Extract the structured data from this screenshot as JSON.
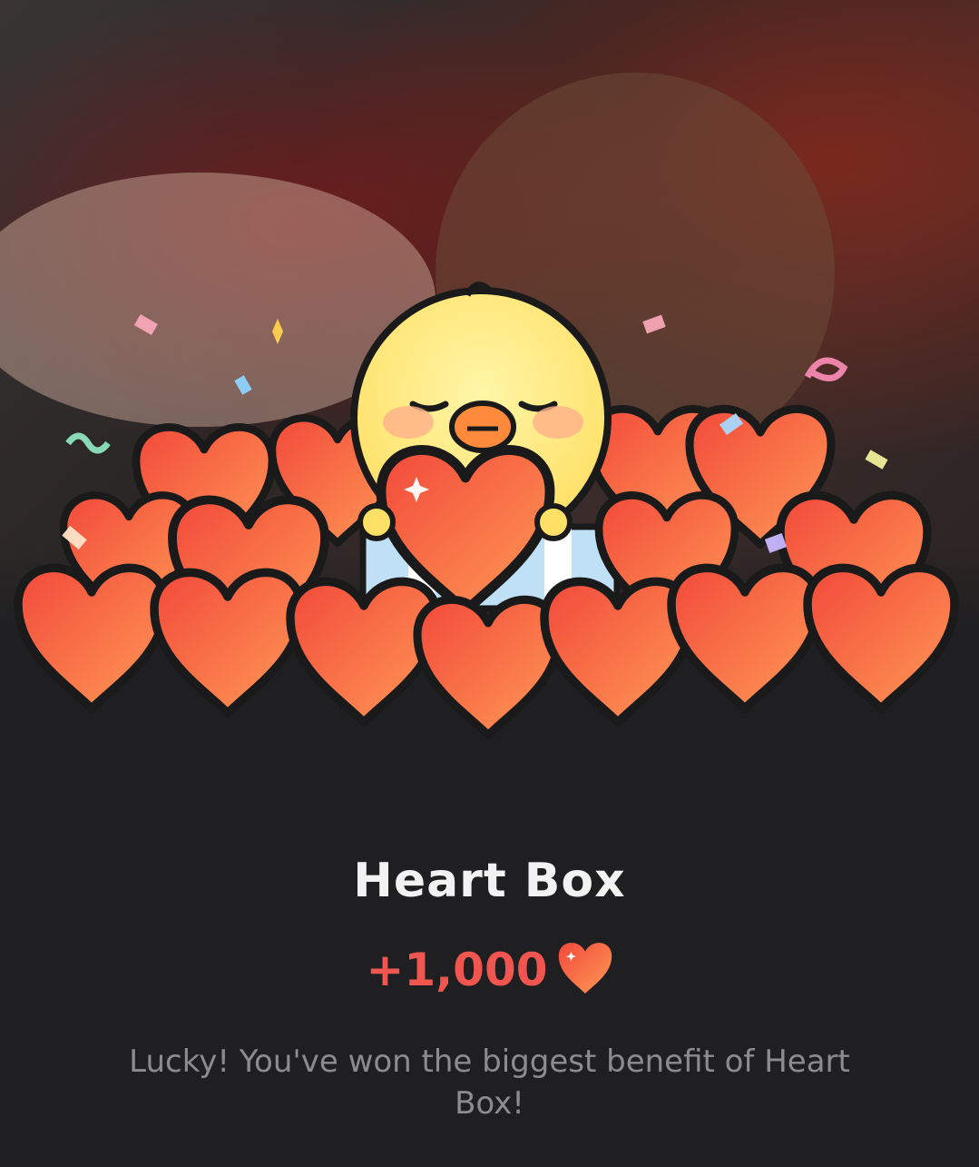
{
  "reward_popup": {
    "title": "Heart Box",
    "amount": "+1,000",
    "amount_icon": "heart-icon",
    "message": "Lucky! You've won the biggest benefit of Heart Box!"
  },
  "colors": {
    "background": "#1f1f21",
    "title": "#f2f2f2",
    "amount": "#f0564f",
    "message": "#8c8c8c",
    "heart": "#f3583f"
  }
}
